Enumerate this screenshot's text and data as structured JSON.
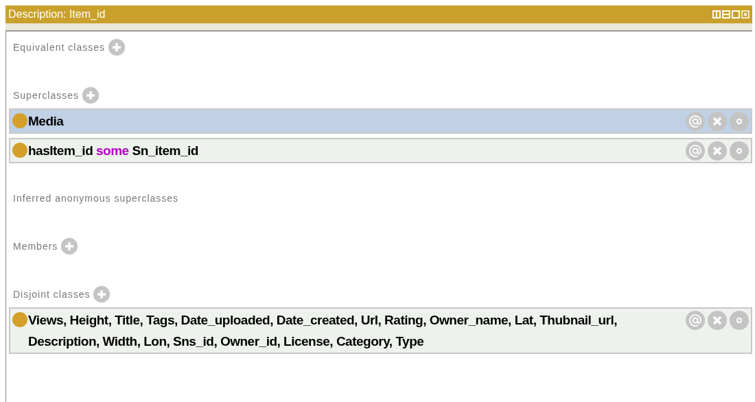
{
  "window": {
    "title": "Description: Item_id"
  },
  "sections": [
    {
      "title": "Equivalent classes",
      "addable": true
    },
    {
      "title": "Superclasses",
      "addable": true,
      "rows": [
        {
          "selected": true,
          "parts": [
            {
              "kind": "name",
              "text": "Media"
            }
          ]
        },
        {
          "selected": false,
          "parts": [
            {
              "kind": "name",
              "text": "hasItem_id"
            },
            {
              "kind": "keyword",
              "text": "some"
            },
            {
              "kind": "name",
              "text": "Sn_item_id"
            }
          ]
        }
      ]
    },
    {
      "title": "Inferred anonymous superclasses",
      "addable": false
    },
    {
      "title": "Members",
      "addable": true
    },
    {
      "title": "Disjoint classes",
      "addable": true,
      "rows": [
        {
          "selected": false,
          "parts": [
            {
              "kind": "name",
              "text": "Views, Height, Title, Tags, Date_uploaded, Date_created, Url, Rating, Owner_name, Lat, Thubnail_url, Description, Width, Lon, Sns_id, Owner_id, License, Category, Type"
            }
          ]
        }
      ]
    }
  ]
}
